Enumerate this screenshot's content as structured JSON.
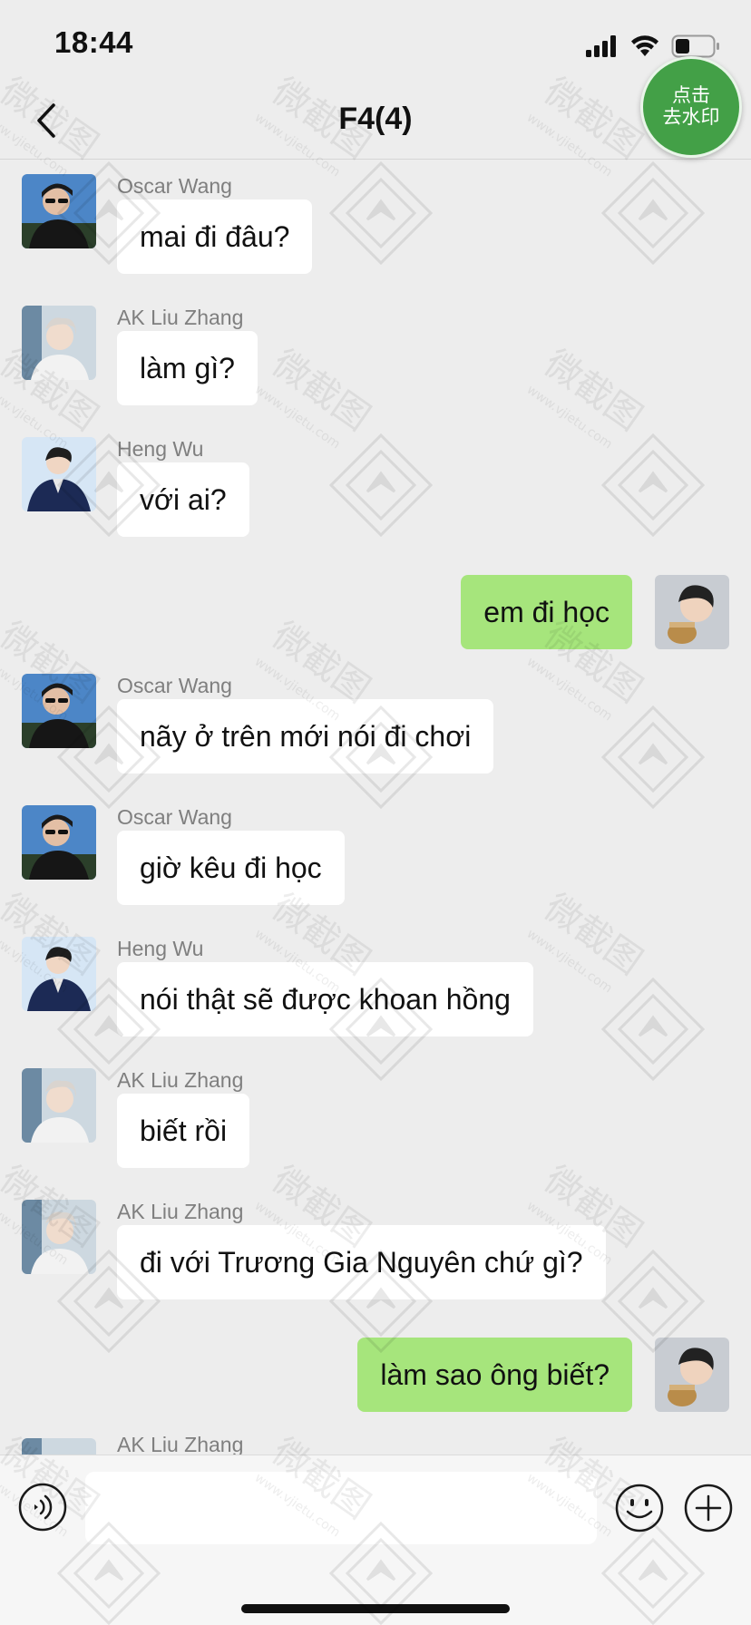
{
  "status_bar": {
    "time": "18:44"
  },
  "header": {
    "title": "F4(4)"
  },
  "watermark_button": {
    "line1": "点击",
    "line2": "去水印"
  },
  "messages": [
    {
      "direction": "in",
      "sender": "Oscar Wang",
      "text": "mai đi đâu?"
    },
    {
      "direction": "in",
      "sender": "AK Liu Zhang",
      "text": "làm gì?"
    },
    {
      "direction": "in",
      "sender": "Heng Wu",
      "text": "với ai?"
    },
    {
      "direction": "out",
      "sender": "",
      "text": "em đi học"
    },
    {
      "direction": "in",
      "sender": "Oscar Wang",
      "text": "nãy ở trên mới nói đi chơi"
    },
    {
      "direction": "in",
      "sender": "Oscar Wang",
      "text": "giờ kêu đi học"
    },
    {
      "direction": "in",
      "sender": "Heng Wu",
      "text": "nói thật sẽ được khoan hồng"
    },
    {
      "direction": "in",
      "sender": "AK Liu Zhang",
      "text": "biết rồi"
    },
    {
      "direction": "in",
      "sender": "AK Liu Zhang",
      "text": "đi với Trương Gia Nguyên chứ gì?"
    },
    {
      "direction": "out",
      "sender": "",
      "text": "làm sao ông biết?"
    },
    {
      "direction": "in",
      "sender": "AK Liu Zhang",
      "text": ""
    }
  ],
  "input": {
    "value": ""
  },
  "colors": {
    "background": "#ededed",
    "outgoing_bubble": "#a6e57c",
    "incoming_bubble": "#ffffff",
    "watermark_button": "#43a047"
  }
}
